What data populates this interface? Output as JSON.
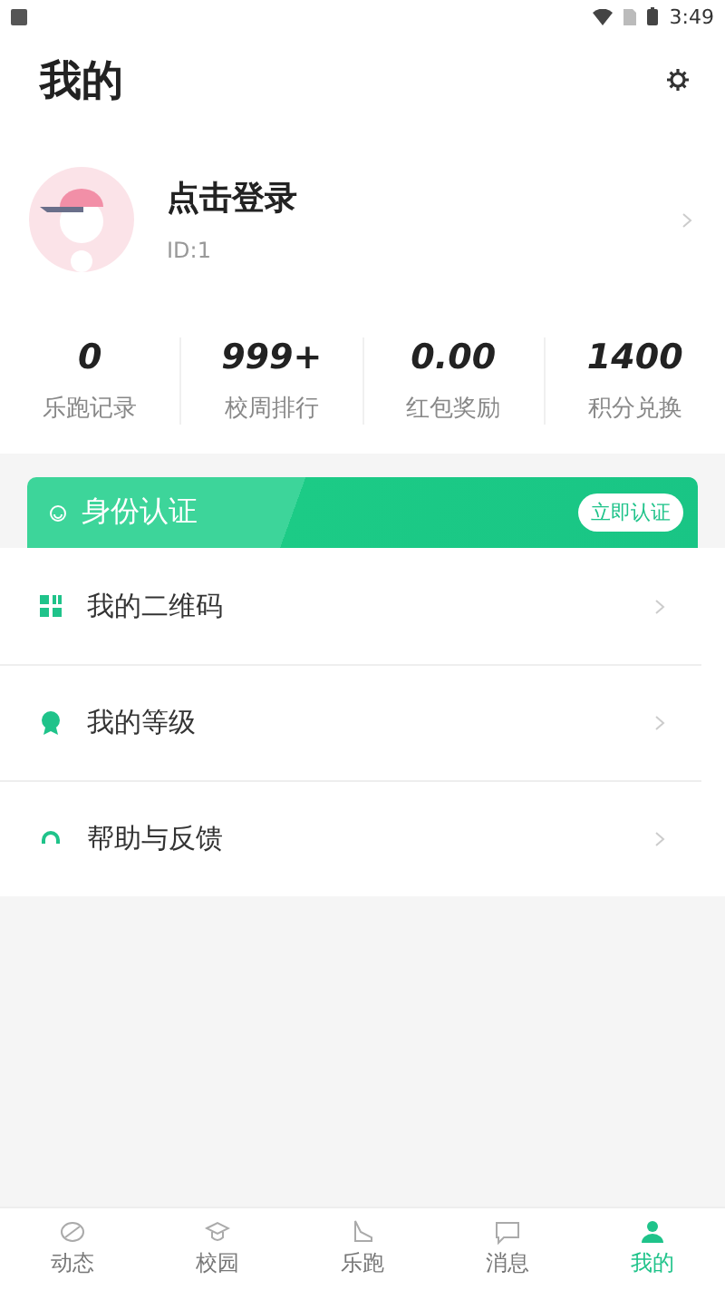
{
  "status_bar": {
    "time": "3:49"
  },
  "header": {
    "title": "我的"
  },
  "profile": {
    "name": "点击登录",
    "id": "ID:1"
  },
  "stats": [
    {
      "value": "0",
      "label": "乐跑记录"
    },
    {
      "value": "999+",
      "label": "校周排行"
    },
    {
      "value": "0.00",
      "label": "红包奖励"
    },
    {
      "value": "1400",
      "label": "积分兑换"
    }
  ],
  "verify_banner": {
    "title": "身份认证",
    "button": "立即认证"
  },
  "menu": [
    {
      "kind": "qrcode",
      "label": "我的二维码"
    },
    {
      "kind": "level",
      "label": "我的等级"
    },
    {
      "kind": "help",
      "label": "帮助与反馈"
    }
  ],
  "tabs": [
    {
      "kind": "feed",
      "label": "动态",
      "selected": false
    },
    {
      "kind": "campus",
      "label": "校园",
      "selected": false
    },
    {
      "kind": "run",
      "label": "乐跑",
      "selected": false
    },
    {
      "kind": "message",
      "label": "消息",
      "selected": false
    },
    {
      "kind": "me",
      "label": "我的",
      "selected": true
    }
  ]
}
